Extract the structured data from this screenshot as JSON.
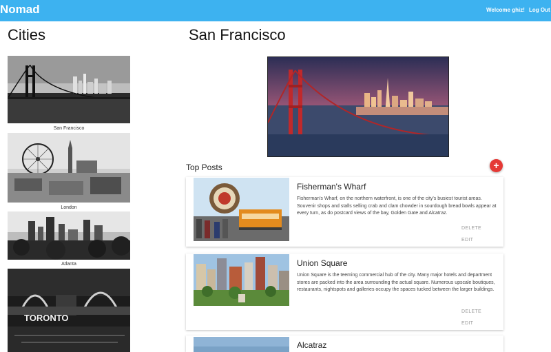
{
  "navbar": {
    "brand": "Nomad",
    "welcome": "Welcome ghiz!",
    "logout": "Log Out",
    "color": "#3db2f0"
  },
  "sidebar": {
    "title": "Cities",
    "cities": [
      {
        "name": "San Francisco"
      },
      {
        "name": "London"
      },
      {
        "name": "Atlanta"
      },
      {
        "name": "Toronto"
      }
    ]
  },
  "main": {
    "city_title": "San Francisco",
    "top_posts_label": "Top Posts",
    "add_button": "+",
    "add_button_color": "#e53935",
    "posts": [
      {
        "title": "Fisherman's Wharf",
        "body": "Fisherman's Wharf, on the northern waterfront, is one of the city's busiest tourist areas. Souvenir shops and stalls selling crab and clam chowder in sourdough bread bowls appear at every turn, as do postcard views of the bay, Golden Gate and Alcatraz.",
        "delete": "DELETE",
        "edit": "EDIT"
      },
      {
        "title": "Union Square",
        "body": "Union Square is the teeming commercial hub of the city. Many major hotels and department stores are packed into the area surrounding the actual square. Numerous upscale boutiques, restaurants, nightspots and galleries occupy the spaces tucked between the larger buildings.",
        "delete": "DELETE",
        "edit": "EDIT"
      },
      {
        "title": "Alcatraz"
      }
    ]
  }
}
